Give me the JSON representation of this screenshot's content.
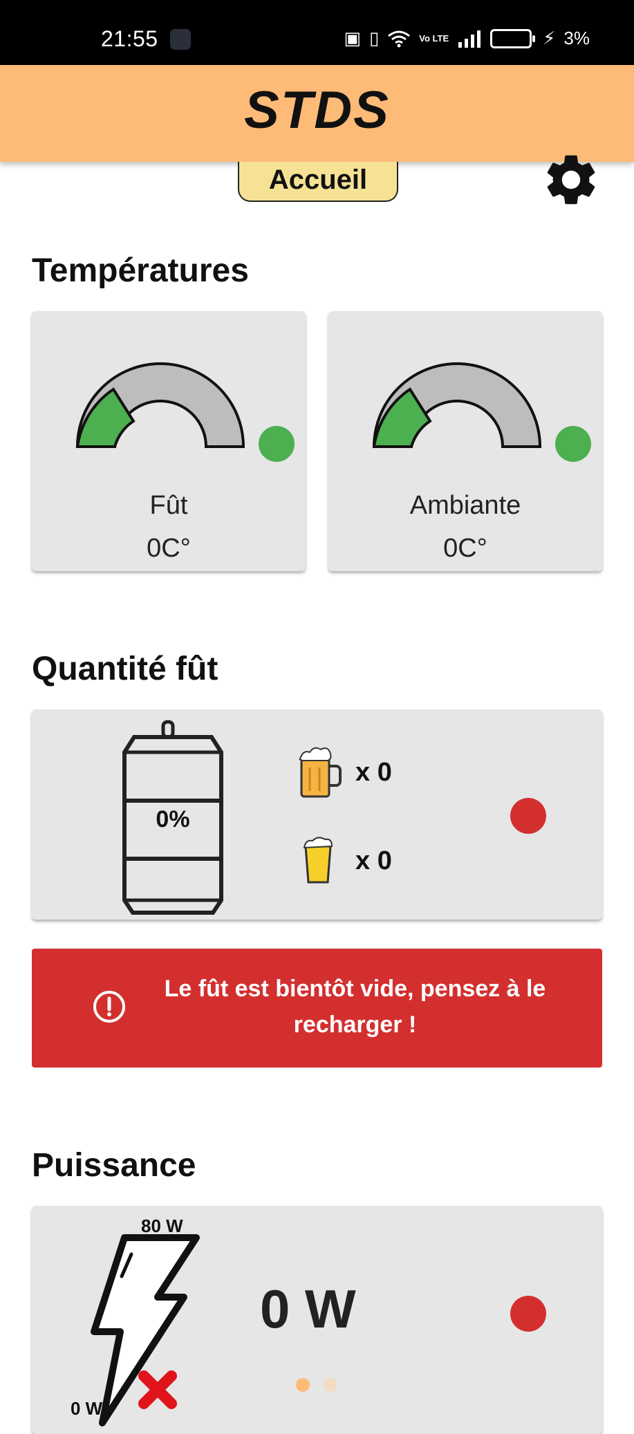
{
  "status_bar": {
    "time": "21:55",
    "battery": "3%",
    "net": "Vo LTE"
  },
  "app_bar": {
    "title": "STDS"
  },
  "tab": {
    "label": "Accueil"
  },
  "temperatures": {
    "title": "Températures",
    "gauges": [
      {
        "label": "Fût",
        "value": "0C°",
        "level": 0.2,
        "status_color": "#4caf50"
      },
      {
        "label": "Ambiante",
        "value": "0C°",
        "level": 0.2,
        "status_color": "#4caf50"
      }
    ]
  },
  "keg": {
    "title": "Quantité fût",
    "percent_text": "0%",
    "level_fraction": 0,
    "pints_text": "x 0",
    "halves_text": "x 0",
    "status_color": "#d32f2f"
  },
  "alert": {
    "message": "Le fût est bientôt vide, pensez à le recharger !"
  },
  "power": {
    "title": "Puissance",
    "max_label": "80 W",
    "min_label": "0 W",
    "value_text": "0 W",
    "status_color": "#d32f2f"
  },
  "colors": {
    "accent": "#fdbb77",
    "gauge_fill": "#4caf50",
    "gauge_bg": "#bdbdbd",
    "alert": "#d32f2f",
    "chip": "#f6e294"
  },
  "pager": {
    "active": 0,
    "count": 2
  }
}
